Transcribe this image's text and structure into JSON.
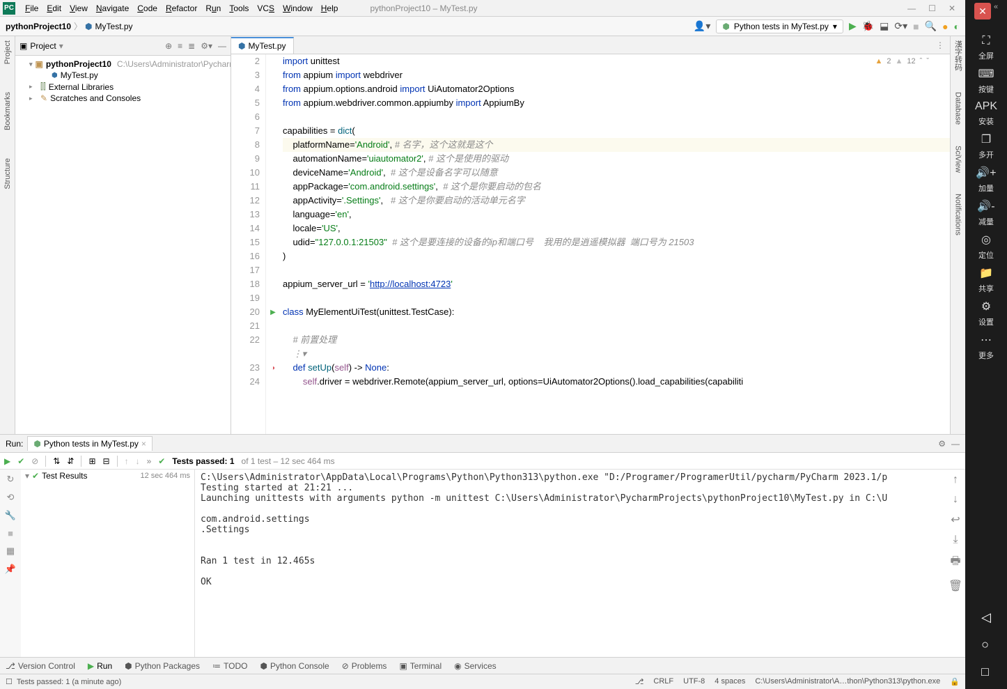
{
  "window": {
    "title": "pythonProject10 – MyTest.py"
  },
  "menu": {
    "items": [
      "File",
      "Edit",
      "View",
      "Navigate",
      "Code",
      "Refactor",
      "Run",
      "Tools",
      "VCS",
      "Window",
      "Help"
    ]
  },
  "breadcrumb": {
    "project": "pythonProject10",
    "file": "MyTest.py"
  },
  "runConfig": {
    "label": "Python tests in MyTest.py"
  },
  "projectPane": {
    "title": "Project",
    "root": {
      "name": "pythonProject10",
      "path": "C:\\Users\\Administrator\\PycharmP"
    },
    "file": "MyTest.py",
    "extLibs": "External Libraries",
    "scratches": "Scratches and Consoles"
  },
  "editor": {
    "tab": "MyTest.py",
    "warnings": {
      "a": "2",
      "b": "12"
    },
    "lines": [
      {
        "n": "2",
        "type": "code",
        "tokens": [
          {
            "t": "import ",
            "c": "kw"
          },
          {
            "t": "unittest"
          }
        ]
      },
      {
        "n": "3",
        "type": "code",
        "tokens": [
          {
            "t": "from ",
            "c": "kw"
          },
          {
            "t": "appium "
          },
          {
            "t": "import ",
            "c": "kw"
          },
          {
            "t": "webdriver"
          }
        ]
      },
      {
        "n": "4",
        "type": "code",
        "tokens": [
          {
            "t": "from ",
            "c": "kw"
          },
          {
            "t": "appium.options.android "
          },
          {
            "t": "import ",
            "c": "kw"
          },
          {
            "t": "UiAutomator2Options"
          }
        ]
      },
      {
        "n": "5",
        "type": "code",
        "tokens": [
          {
            "t": "from ",
            "c": "kw"
          },
          {
            "t": "appium.webdriver.common.appiumby "
          },
          {
            "t": "import ",
            "c": "kw"
          },
          {
            "t": "AppiumBy"
          }
        ]
      },
      {
        "n": "6",
        "type": "blank"
      },
      {
        "n": "7",
        "type": "code",
        "tokens": [
          {
            "t": "capabilities = "
          },
          {
            "t": "dict",
            "c": "fn"
          },
          {
            "t": "("
          }
        ]
      },
      {
        "n": "8",
        "type": "code",
        "hl": true,
        "tokens": [
          {
            "t": "    platformName="
          },
          {
            "t": "'Android'",
            "c": "str"
          },
          {
            "t": ", "
          },
          {
            "t": "# 名字，这个这就是这个",
            "c": "cmt"
          }
        ]
      },
      {
        "n": "9",
        "type": "code",
        "tokens": [
          {
            "t": "    automationName="
          },
          {
            "t": "'uiautomator2'",
            "c": "str"
          },
          {
            "t": ", "
          },
          {
            "t": "# 这个是使用的驱动",
            "c": "cmt"
          }
        ]
      },
      {
        "n": "10",
        "type": "code",
        "tokens": [
          {
            "t": "    deviceName="
          },
          {
            "t": "'Android'",
            "c": "str"
          },
          {
            "t": ",  "
          },
          {
            "t": "# 这个是设备名字可以随意",
            "c": "cmt"
          }
        ]
      },
      {
        "n": "11",
        "type": "code",
        "tokens": [
          {
            "t": "    appPackage="
          },
          {
            "t": "'com.android.settings'",
            "c": "str"
          },
          {
            "t": ",  "
          },
          {
            "t": "# 这个是你要启动的包名",
            "c": "cmt"
          }
        ]
      },
      {
        "n": "12",
        "type": "code",
        "tokens": [
          {
            "t": "    appActivity="
          },
          {
            "t": "'.Settings'",
            "c": "str"
          },
          {
            "t": ",   "
          },
          {
            "t": "# 这个是你要启动的活动单元名字",
            "c": "cmt"
          }
        ]
      },
      {
        "n": "13",
        "type": "code",
        "tokens": [
          {
            "t": "    language="
          },
          {
            "t": "'en'",
            "c": "str"
          },
          {
            "t": ","
          }
        ]
      },
      {
        "n": "14",
        "type": "code",
        "tokens": [
          {
            "t": "    locale="
          },
          {
            "t": "'US'",
            "c": "str"
          },
          {
            "t": ","
          }
        ]
      },
      {
        "n": "15",
        "type": "code",
        "tokens": [
          {
            "t": "    udid="
          },
          {
            "t": "\"127.0.0.1:21503\"",
            "c": "str"
          },
          {
            "t": "  "
          },
          {
            "t": "# 这个是要连接的设备的ip和端口号    我用的是逍遥模拟器  端口号为 21503",
            "c": "cmt"
          }
        ]
      },
      {
        "n": "16",
        "type": "code",
        "tokens": [
          {
            "t": ")"
          }
        ]
      },
      {
        "n": "17",
        "type": "blank"
      },
      {
        "n": "18",
        "type": "code",
        "tokens": [
          {
            "t": "appium_server_url = "
          },
          {
            "t": "'",
            "c": "str"
          },
          {
            "t": "http://localhost:4723",
            "c": "url"
          },
          {
            "t": "'",
            "c": "str"
          }
        ]
      },
      {
        "n": "19",
        "type": "blank"
      },
      {
        "n": "20",
        "type": "code",
        "gicon": "▶",
        "tokens": [
          {
            "t": "class ",
            "c": "kw"
          },
          {
            "t": "MyElementUiTest"
          },
          {
            "t": "(unittest.TestCase):"
          }
        ]
      },
      {
        "n": "21",
        "type": "blank"
      },
      {
        "n": "22",
        "type": "code",
        "tokens": [
          {
            "t": "    "
          },
          {
            "t": "# 前置处理",
            "c": "cmt"
          }
        ]
      },
      {
        "n": "",
        "type": "code",
        "tokens": [
          {
            "t": "    ⋮▾",
            "c": "cmt"
          }
        ]
      },
      {
        "n": "23",
        "type": "code",
        "gicon": "●",
        "tokens": [
          {
            "t": "    "
          },
          {
            "t": "def ",
            "c": "kw"
          },
          {
            "t": "setUp",
            "c": "fn"
          },
          {
            "t": "("
          },
          {
            "t": "self",
            "c": "self"
          },
          {
            "t": ") -> "
          },
          {
            "t": "None",
            "c": "kw"
          },
          {
            "t": ":"
          }
        ]
      },
      {
        "n": "24",
        "type": "code",
        "tokens": [
          {
            "t": "        "
          },
          {
            "t": "self",
            "c": "self"
          },
          {
            "t": ".driver = webdriver.Remote(appium_server_url, options=UiAutomator2Options().load_capabilities(capabiliti"
          }
        ]
      }
    ]
  },
  "runPanel": {
    "label": "Run:",
    "tab": "Python tests in MyTest.py",
    "testsPassed": "Tests passed: 1",
    "testsOf": " of 1 test – 12 sec 464 ms",
    "testResults": "Test Results",
    "testTime": "12 sec 464 ms",
    "console": [
      "C:\\Users\\Administrator\\AppData\\Local\\Programs\\Python\\Python313\\python.exe \"D:/Programer/ProgramerUtil/pycharm/PyCharm 2023.1/p",
      "Testing started at 21:21 ...",
      "Launching unittests with arguments python -m unittest C:\\Users\\Administrator\\PycharmProjects\\pythonProject10\\MyTest.py in C:\\U",
      "",
      "com.android.settings",
      ".Settings",
      "",
      "",
      "Ran 1 test in 12.465s",
      "",
      "OK"
    ]
  },
  "bottomTabs": {
    "version": "Version Control",
    "run": "Run",
    "packages": "Python Packages",
    "todo": "TODO",
    "console": "Python Console",
    "problems": "Problems",
    "terminal": "Terminal",
    "services": "Services"
  },
  "statusBar": {
    "left": "Tests passed: 1 (a minute ago)",
    "crlf": "CRLF",
    "enc": "UTF-8",
    "indent": "4 spaces",
    "interp": "C:\\Users\\Administrator\\A…thon\\Python313\\python.exe"
  },
  "rightSidebar": {
    "items": [
      {
        "icon": "⛶",
        "label": "全屏"
      },
      {
        "icon": "⌨",
        "label": "按键"
      },
      {
        "icon": "APK",
        "label": "安装"
      },
      {
        "icon": "❐",
        "label": "多开"
      },
      {
        "icon": "🔊+",
        "label": "加量"
      },
      {
        "icon": "🔊-",
        "label": "减量"
      },
      {
        "icon": "◎",
        "label": "定位"
      },
      {
        "icon": "📁",
        "label": "共享"
      },
      {
        "icon": "⚙",
        "label": "设置"
      },
      {
        "icon": "⋯",
        "label": "更多"
      }
    ],
    "navIcons": [
      "◁",
      "○",
      "□"
    ]
  },
  "leftTabs": [
    "Project",
    "Bookmarks",
    "Structure"
  ],
  "rightTabs": [
    "漢字转码",
    "Database",
    "SciView",
    "Notifications"
  ]
}
